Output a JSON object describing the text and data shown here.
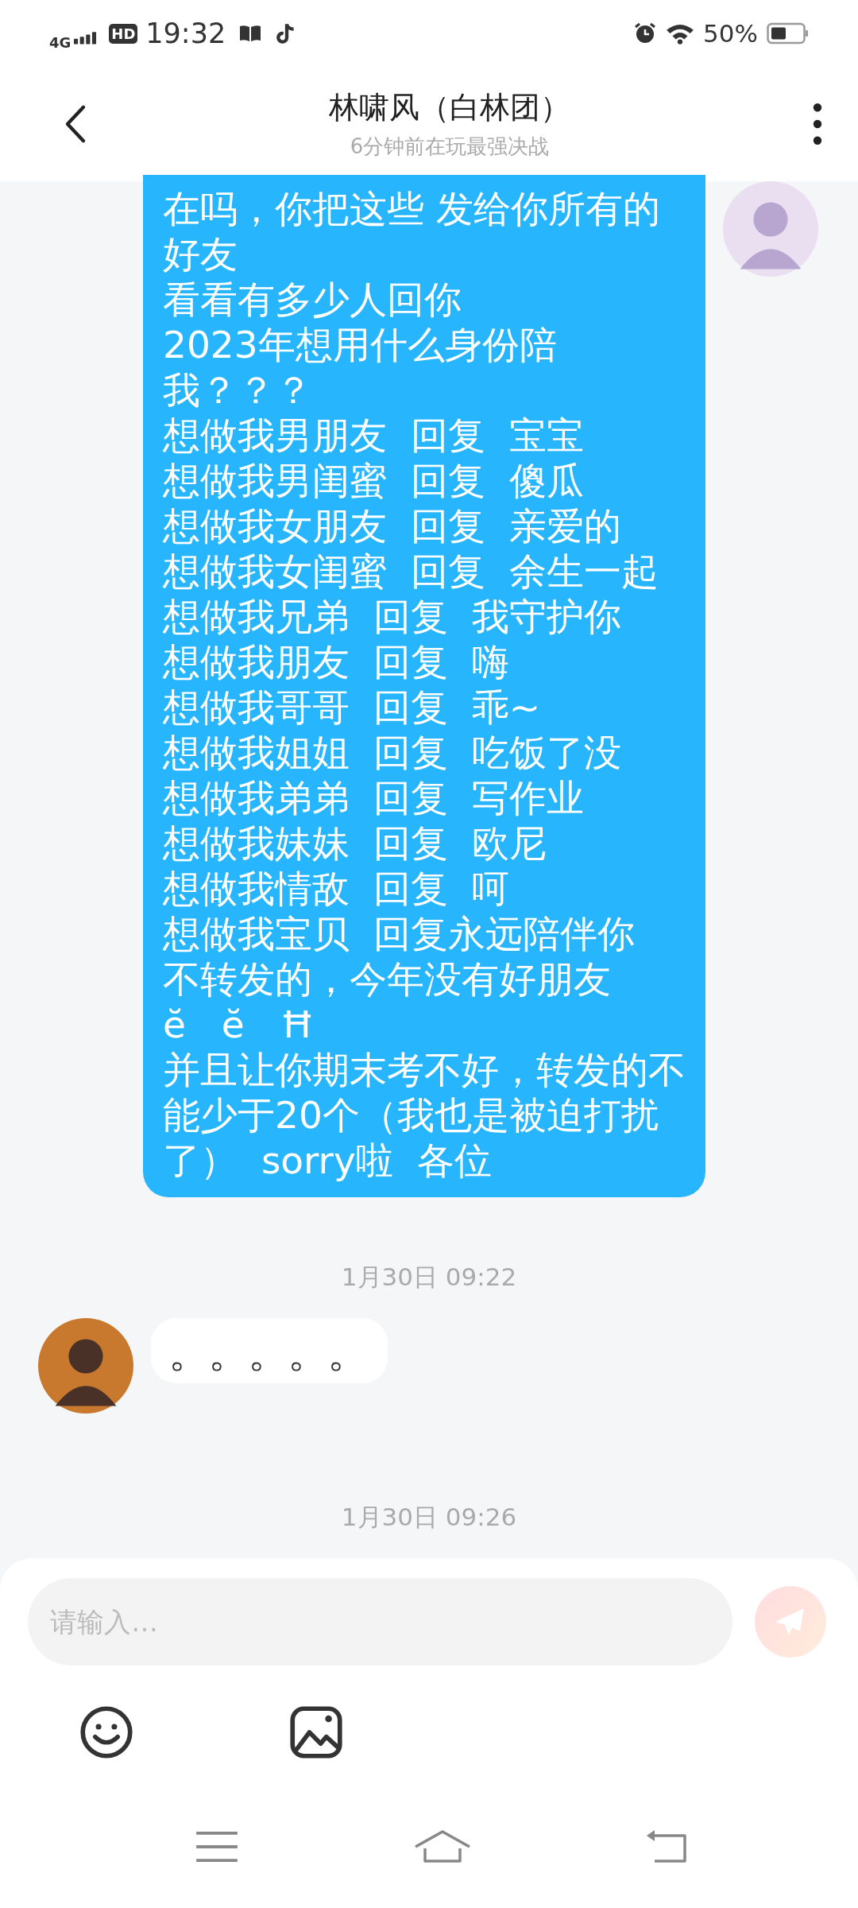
{
  "status_bar": {
    "network": "4G",
    "hd": "HD",
    "time": "19:32",
    "battery": "50%"
  },
  "header": {
    "title": "林啸风（白林团）",
    "subtitle": "6分钟前在玩最强决战"
  },
  "messages": [
    {
      "kind": "sent",
      "lines": [
        "在吗，你把这些 发给你所有的好友",
        "看看有多少人回你",
        "2023年想用什么身份陪我？？？",
        "想做我男朋友  回复  宝宝",
        "想做我男闺蜜  回复  傻瓜",
        "想做我女朋友  回复  亲爱的",
        "想做我女闺蜜  回复  余生一起",
        "想做我兄弟  回复  我守护你",
        "想做我朋友  回复  嗨",
        "想做我哥哥  回复  乖~",
        "想做我姐姐  回复  吃饭了没",
        "想做我弟弟  回复  写作业",
        "想做我妹妹  回复  欧尼",
        "想做我情敌  回复  呵",
        "想做我宝贝  回复永远陪伴你",
        "不转发的，今年没有好朋友",
        "ĕ   ĕ   Ħ",
        "并且让你期末考不好，转发的不能少于20个（我也是被迫打扰了）  sorry啦  各位"
      ]
    },
    {
      "kind": "timestamp",
      "text": "1月30日  09:22"
    },
    {
      "kind": "received",
      "lines": [
        "。。。。。"
      ]
    },
    {
      "kind": "timestamp",
      "text": "1月30日  09:26"
    }
  ],
  "composer": {
    "placeholder": "请输入…",
    "send_disabled": true
  }
}
